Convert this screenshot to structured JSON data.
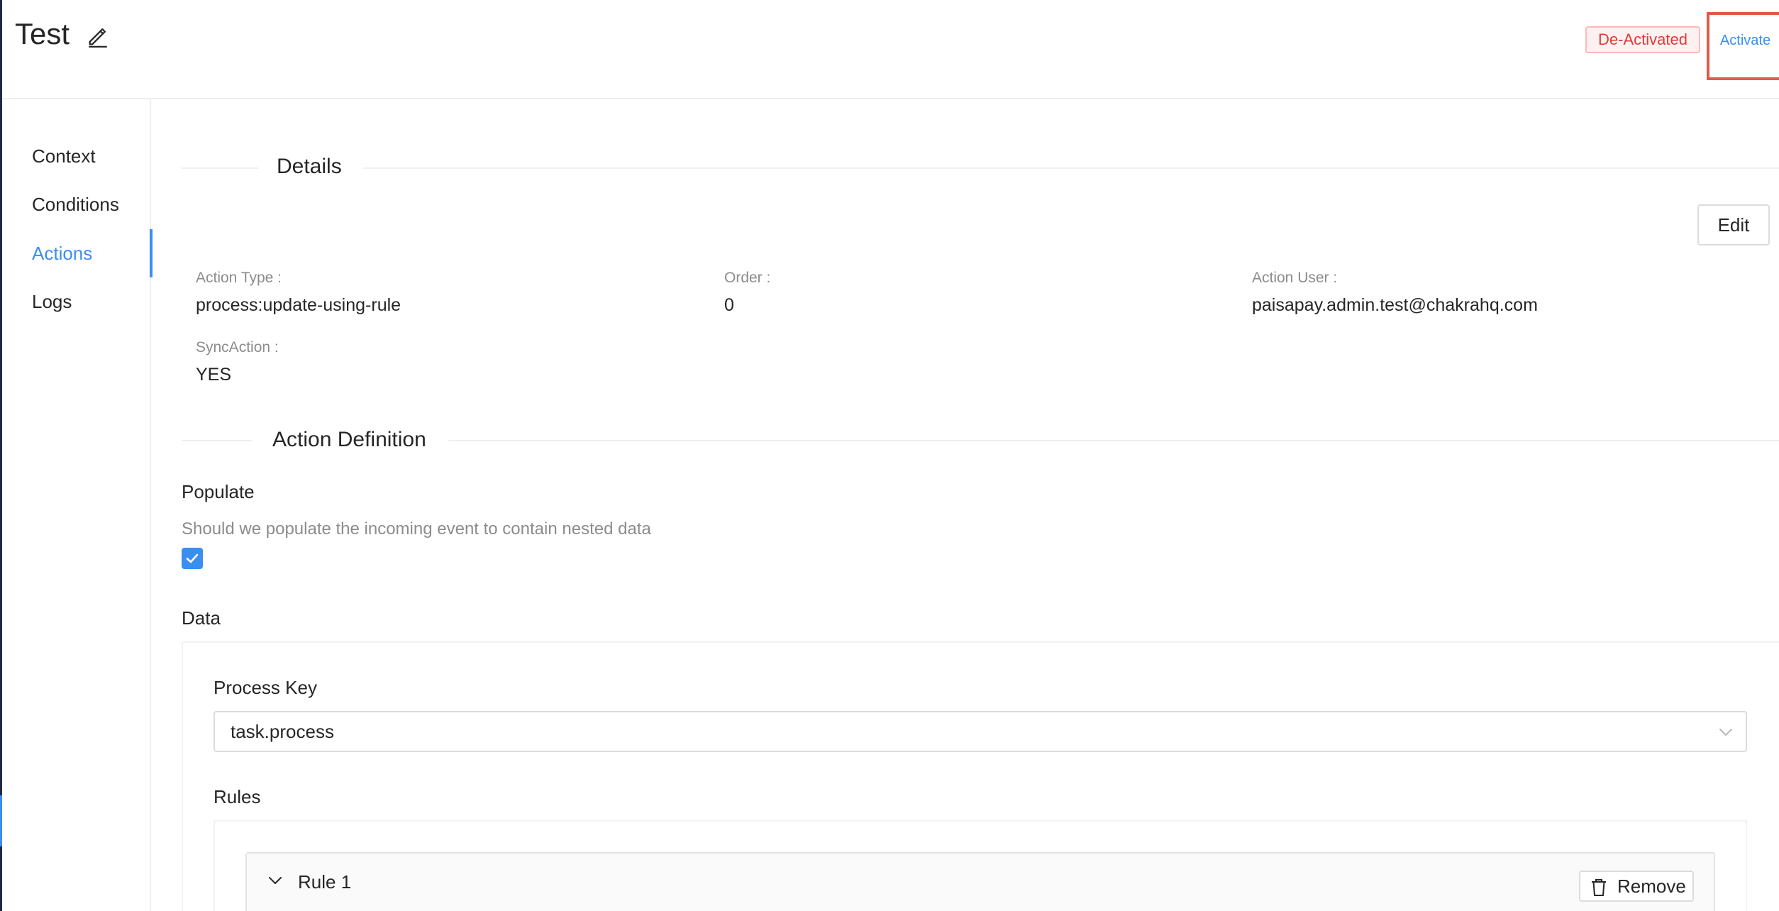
{
  "header": {
    "title": "Test",
    "status": "De-Activated",
    "activate_label": "Activate"
  },
  "sidebar": {
    "items": [
      {
        "label": "Context"
      },
      {
        "label": "Conditions"
      },
      {
        "label": "Actions",
        "active": true
      },
      {
        "label": "Logs"
      }
    ]
  },
  "details": {
    "title": "Details",
    "edit_label": "Edit",
    "fields": [
      {
        "label": "Action Type :",
        "value": "process:update-using-rule"
      },
      {
        "label": "Order :",
        "value": "0"
      },
      {
        "label": "Action User :",
        "value": "paisapay.admin.test@chakrahq.com"
      },
      {
        "label": "SyncAction :",
        "value": "YES"
      }
    ]
  },
  "action_definition": {
    "title": "Action Definition",
    "populate_label": "Populate",
    "populate_help": "Should we populate the incoming event to contain nested data",
    "populate_checked": true,
    "data_label": "Data",
    "process_key_label": "Process Key",
    "process_key_value": "task.process",
    "rules_label": "Rules",
    "rules": [
      {
        "title": "Rule 1",
        "remove_label": "Remove"
      }
    ]
  },
  "colors": {
    "accent": "#3a8ef0",
    "danger": "#e03a3a",
    "highlight": "#e05a4a"
  }
}
